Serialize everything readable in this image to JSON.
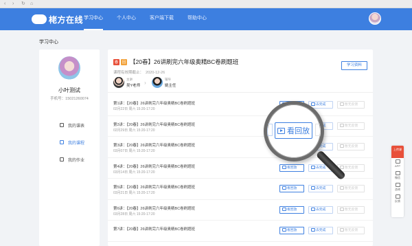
{
  "browser": {
    "back": "‹",
    "forward": "›",
    "reload": "↻",
    "home": "⌂"
  },
  "app": {
    "logo_badge": "",
    "logo_text": "栳方在线"
  },
  "nav": [
    {
      "label": "学习中心",
      "active": true
    },
    {
      "label": "个人中心",
      "active": false
    },
    {
      "label": "客户端下载",
      "active": false
    },
    {
      "label": "帮助中心",
      "active": false
    }
  ],
  "page_title": "学习中心",
  "profile": {
    "name": "小叶测试",
    "phone": "手机号：15021260074",
    "menu": [
      {
        "label": "我的课表",
        "icon": "calendar-icon",
        "active": false
      },
      {
        "label": "我的课程",
        "icon": "course-icon",
        "active": true
      },
      {
        "label": "我的作业",
        "icon": "homework-icon",
        "active": false
      }
    ]
  },
  "course": {
    "tag1": "春",
    "tag2": "回",
    "title": "【20春】26讲刷完六年级奥精BC卷刷题班",
    "deadline_label": "课程有效期截止：",
    "deadline": "2020-12-26",
    "materials_button": "学习资料",
    "teacher1": {
      "role": "主讲",
      "name": "吴Y老师"
    },
    "teacher2": {
      "role": "辅导",
      "name": "姚主任"
    },
    "arrow": "›"
  },
  "lessons": [
    {
      "title": "第1讲：【20春】26讲刷完六年级奥精BC卷刷题班",
      "time": "02月22日 周六 15:20-17:20"
    },
    {
      "title": "第2讲：【20春】26讲刷完六年级奥精BC卷刷题班",
      "time": "02月29日 周六 15:20-17:20"
    },
    {
      "title": "第3讲：【20春】26讲刷完六年级奥精BC卷刷题班",
      "time": "03月07日 周六 15:20-17:20"
    },
    {
      "title": "第4讲：【20春】26讲刷完六年级奥精BC卷刷题班",
      "time": "03月14日 周六 15:20-17:20"
    },
    {
      "title": "第5讲：【20春】26讲刷完六年级奥精BC卷刷题班",
      "time": "03月21日 周六 15:20-17:20"
    },
    {
      "title": "第6讲：【20春】26讲刷完六年级奥精BC卷刷题班",
      "time": "03月28日 周六 15:20-17:20"
    },
    {
      "title": "第7讲：【20春】26讲刷完六年级奥精BC卷刷题班",
      "time": ""
    }
  ],
  "lesson_buttons": {
    "replay": "看回放",
    "done": "去完成",
    "feedback": "暂无反馈"
  },
  "magnifier": {
    "label": "看回放"
  },
  "float_bar": {
    "top": "上传课",
    "items": [
      {
        "label": "APP",
        "icon": "app-icon"
      },
      {
        "label": "微信",
        "icon": "wechat-icon"
      },
      {
        "label": "咨询",
        "icon": "consult-icon"
      },
      {
        "label": "反馈",
        "icon": "feedback-icon"
      }
    ]
  },
  "colors": {
    "primary": "#3d7fe0",
    "tag_red": "#e8503a",
    "tag_orange": "#f2a23a",
    "background": "#f1f3f6"
  }
}
